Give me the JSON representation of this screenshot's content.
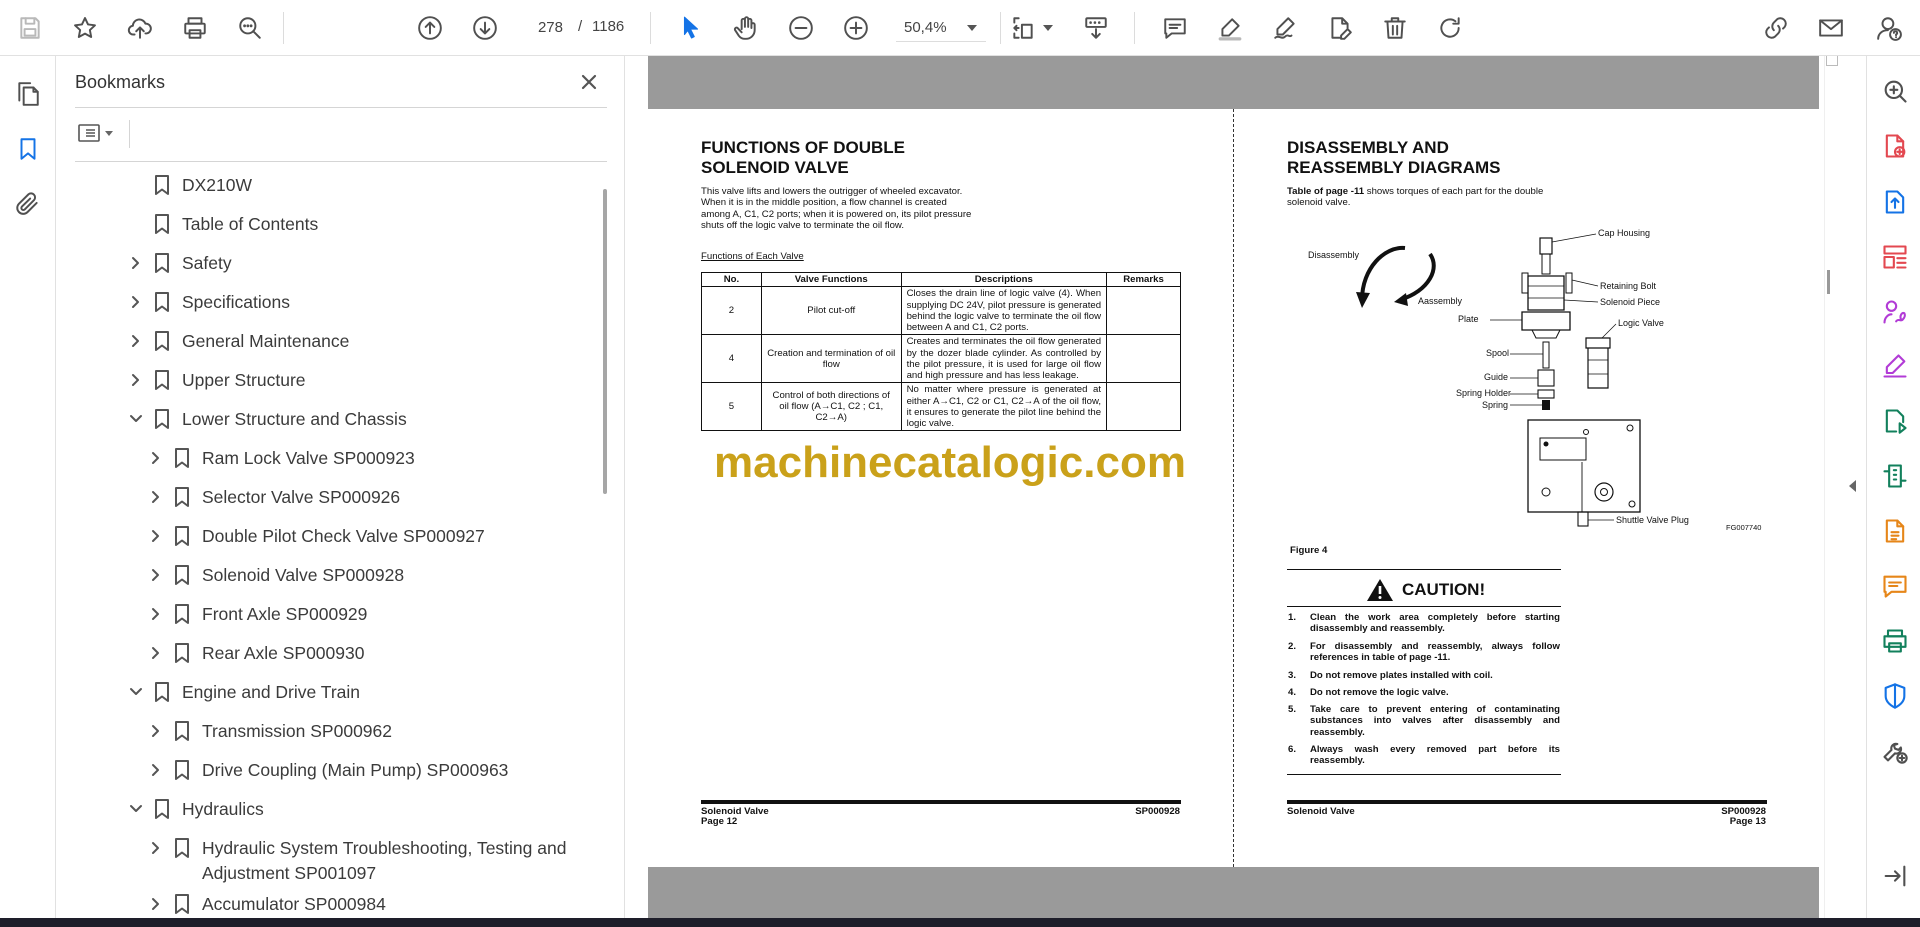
{
  "toolbar": {
    "page_current": "278",
    "page_separator": "/",
    "page_total": "1186",
    "zoom": "50,4%",
    "icons": [
      "save-icon",
      "bookmark-star-icon",
      "upload-icon",
      "print-icon",
      "find-icon",
      "page-up-icon",
      "page-down-icon",
      "select-cursor-icon",
      "hand-icon",
      "zoom-out-icon",
      "zoom-in-icon",
      "page-display-icon",
      "scroll-mode-icon",
      "comment-icon",
      "highlight-icon",
      "sign-icon",
      "edit-pdf-icon",
      "delete-icon",
      "rotate-icon",
      "share-link-icon",
      "email-icon",
      "account-help-icon"
    ]
  },
  "bookmarks": {
    "title": "Bookmarks",
    "items": [
      {
        "label": "DX210W",
        "level": 0,
        "expand": "none"
      },
      {
        "label": "Table of Contents",
        "level": 0,
        "expand": "none"
      },
      {
        "label": "Safety",
        "level": 0,
        "expand": "collapsed"
      },
      {
        "label": "Specifications",
        "level": 0,
        "expand": "collapsed"
      },
      {
        "label": "General Maintenance",
        "level": 0,
        "expand": "collapsed"
      },
      {
        "label": "Upper Structure",
        "level": 0,
        "expand": "collapsed"
      },
      {
        "label": "Lower Structure and Chassis",
        "level": 0,
        "expand": "expanded"
      },
      {
        "label": "Ram Lock Valve SP000923",
        "level": 1,
        "expand": "collapsed"
      },
      {
        "label": "Selector Valve SP000926",
        "level": 1,
        "expand": "collapsed"
      },
      {
        "label": "Double Pilot Check Valve SP000927",
        "level": 1,
        "expand": "collapsed"
      },
      {
        "label": "Solenoid Valve SP000928",
        "level": 1,
        "expand": "collapsed"
      },
      {
        "label": "Front Axle SP000929",
        "level": 1,
        "expand": "collapsed"
      },
      {
        "label": "Rear Axle SP000930",
        "level": 1,
        "expand": "collapsed"
      },
      {
        "label": "Engine and Drive Train",
        "level": 0,
        "expand": "expanded"
      },
      {
        "label": "Transmission SP000962",
        "level": 1,
        "expand": "collapsed"
      },
      {
        "label": "Drive Coupling (Main Pump) SP000963",
        "level": 1,
        "expand": "collapsed"
      },
      {
        "label": "Hydraulics",
        "level": 0,
        "expand": "expanded"
      },
      {
        "label": "Hydraulic System Troubleshooting, Testing and",
        "label2": "Adjustment SP001097",
        "level": 1,
        "expand": "collapsed"
      },
      {
        "label": "Accumulator SP000984",
        "level": 1,
        "expand": "collapsed"
      }
    ]
  },
  "left_page": {
    "title_line1": "FUNCTIONS OF DOUBLE",
    "title_line2": "SOLENOID VALVE",
    "intro_lines": [
      "This valve lifts and lowers the outrigger of wheeled excavator.",
      "When it is in the middle position, a flow channel is created",
      "among A, C1, C2 ports; when it is powered on, its pilot pressure",
      "shuts off the logic valve to terminate the oil flow."
    ],
    "table_caption": "Functions of Each Valve",
    "table_headers": [
      "No.",
      "Valve Functions",
      "Descriptions",
      "Remarks"
    ],
    "table_rows": [
      {
        "no": "2",
        "function": "Pilot cut-off",
        "description": "Closes the drain line of logic valve (4). When supplying DC 24V, pilot pressure is generated behind the logic valve to terminate the oil flow between A and C1, C2 ports.",
        "remarks": ""
      },
      {
        "no": "4",
        "function": "Creation and termination of oil flow",
        "description": "Creates and terminates the oil flow generated by the dozer blade cylinder. As controlled by the pilot pressure, it is used for large oil flow and high pressure and has less leakage.",
        "remarks": ""
      },
      {
        "no": "5",
        "function": "Control of both directions of oil flow (A→C1, C2 ; C1, C2→A)",
        "description": "No matter where pressure is generated at either A→C1, C2 or C1, C2→A of the oil flow, it ensures to generate the pilot line behind the logic valve.",
        "remarks": ""
      }
    ],
    "watermark": "machinecatalogic.com",
    "footer_left": "Solenoid Valve",
    "footer_page": "Page 12",
    "footer_right": "SP000928"
  },
  "right_page": {
    "title_line1": "DISASSEMBLY AND",
    "title_line2": "REASSEMBLY DIAGRAMS",
    "intro_bold": "Table of page -11",
    "intro_rest1": " shows torques of each part for the double",
    "intro_rest2": "solenoid valve.",
    "diagram_labels": {
      "disassembly": "Disassembly",
      "assembly": "Aassembly",
      "cap_housing": "Cap Housing",
      "retaining_bolt": "Retaining Bolt",
      "solenoid_piece": "Solenoid Piece",
      "plate": "Plate",
      "logic_valve": "Logic Valve",
      "spool": "Spool",
      "guide": "Guide",
      "spring_holder": "Spring Holder",
      "spring": "Spring",
      "shuttle_valve_plug": "Shuttle Valve Plug",
      "figure_code": "FG007740"
    },
    "figure_label": "Figure 4",
    "caution_title": "CAUTION!",
    "caution_items": [
      "Clean the work area completely before starting disassembly and reassembly.",
      "For disassembly and reassembly, always follow references in table of page -11.",
      "Do not remove plates installed with coil.",
      "Do not remove the logic valve.",
      "Take care to prevent entering of contaminating substances into valves after disassembly and reassembly.",
      "Always wash every removed part before its reassembly."
    ],
    "footer_left": "Solenoid Valve",
    "footer_right": "SP000928",
    "footer_page": "Page 13"
  },
  "right_rail": {
    "icons": [
      "zoom-search-icon",
      "create-pdf-icon",
      "export-pdf-icon",
      "organize-pages-icon",
      "request-signature-icon",
      "fill-sign-icon",
      "send-for-review-icon",
      "compress-pdf-icon",
      "combine-files-icon",
      "comment-tool-icon",
      "print-production-icon",
      "protect-icon",
      "more-tools-icon",
      "panel-toggle-icon"
    ],
    "colors": [
      "#505050",
      "#e34850",
      "#1473e6",
      "#e34850",
      "#b23bd6",
      "#b23bd6",
      "#12805c",
      "#12805c",
      "#e68619",
      "#e68619",
      "#12805c",
      "#1473e6",
      "#505050",
      "#505050"
    ]
  },
  "colors": {
    "accent": "#1473e6",
    "watermark": "#caa11a",
    "doc_gutter": "#9a9a9a"
  }
}
